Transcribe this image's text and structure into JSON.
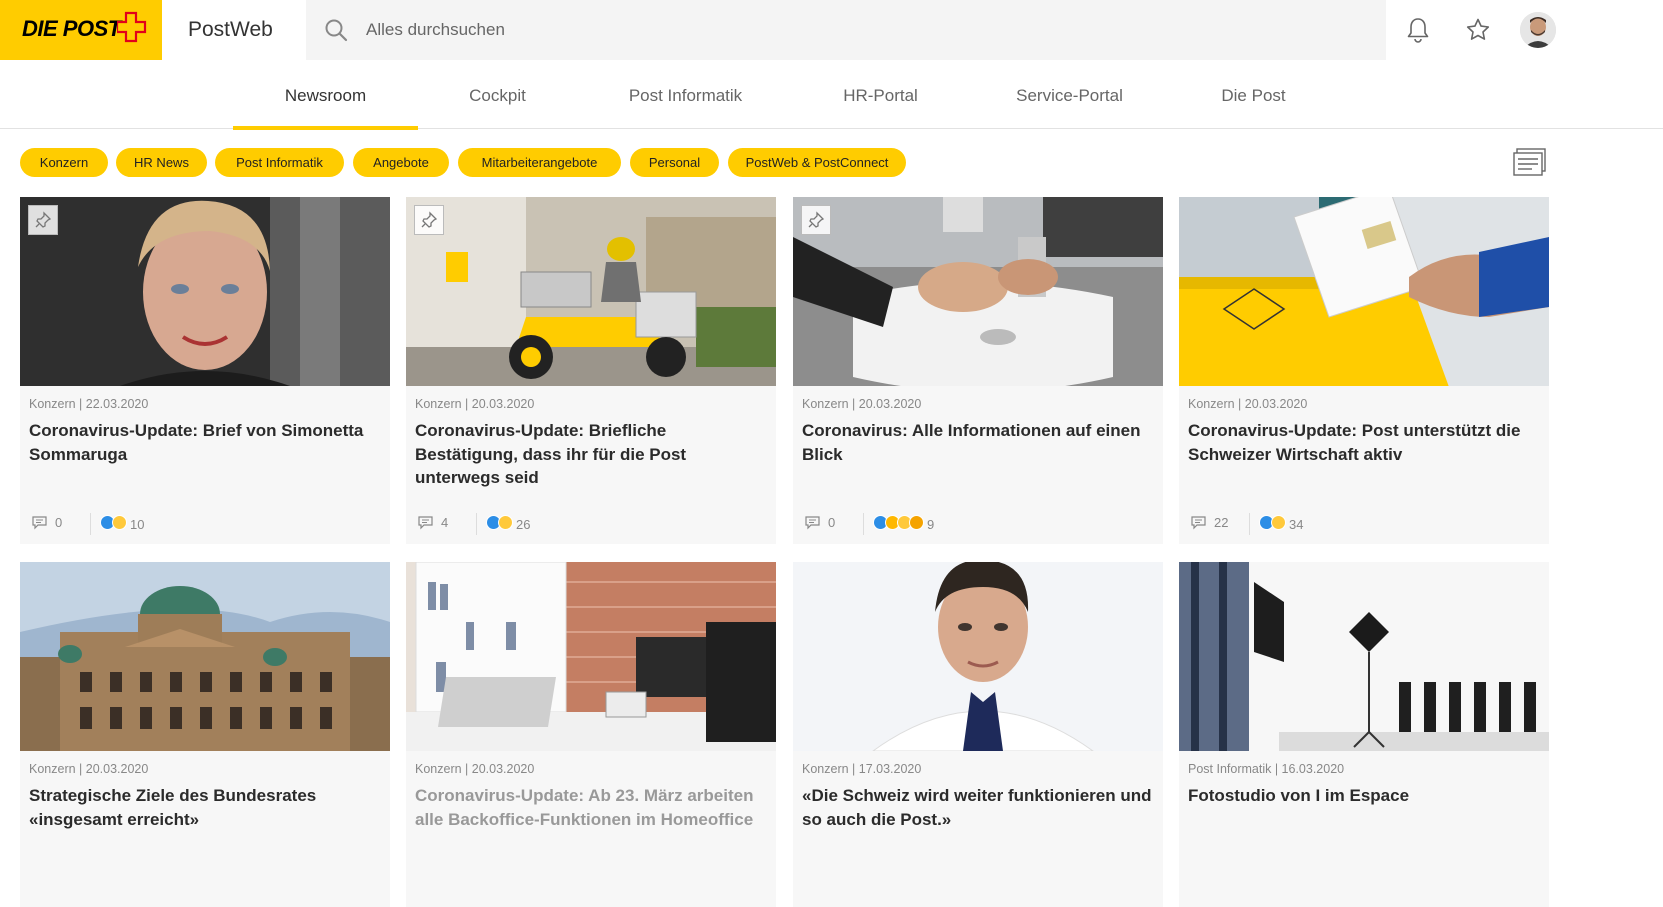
{
  "header": {
    "logo_text": "DIE POST",
    "app_name": "PostWeb",
    "search_placeholder": "Alles durchsuchen"
  },
  "nav": {
    "tabs": [
      {
        "label": "Newsroom",
        "active": true
      },
      {
        "label": "Cockpit"
      },
      {
        "label": "Post Informatik"
      },
      {
        "label": "HR-Portal"
      },
      {
        "label": "Service-Portal"
      },
      {
        "label": "Die Post"
      }
    ]
  },
  "filters": [
    "Konzern",
    "HR News",
    "Post Informatik",
    "Angebote",
    "Mitarbeiterangebote",
    "Personal",
    "PostWeb & PostConnect"
  ],
  "colors": {
    "brand_yellow": "#ffcc00",
    "like_blue": "#2d8ee6"
  },
  "cards": [
    {
      "meta": "Konzern | 22.03.2020",
      "title": "Coronavirus-Update: Brief von Simonetta Sommaruga",
      "comments": "0",
      "reactions": "10",
      "pinned": true
    },
    {
      "meta": "Konzern | 20.03.2020",
      "title": "Coronavirus-Update: Briefliche Bestätigung, dass ihr für die Post unterwegs seid",
      "comments": "4",
      "reactions": "26",
      "pinned": true
    },
    {
      "meta": "Konzern | 20.03.2020",
      "title": "Coronavirus: Alle Informationen auf einen Blick",
      "comments": "0",
      "reactions": "9",
      "pinned": true
    },
    {
      "meta": "Konzern | 20.03.2020",
      "title": "Coronavirus-Update: Post unterstützt die Schweizer Wirtschaft aktiv",
      "comments": "22",
      "reactions": "34",
      "pinned": false
    },
    {
      "meta": "Konzern | 20.03.2020",
      "title": "Strategische Ziele des Bundesrates «insgesamt erreicht»"
    },
    {
      "meta": "Konzern | 20.03.2020",
      "title": "Coronavirus-Update: Ab 23. März arbeiten alle Backoffice-Funktionen im Homeoffice"
    },
    {
      "meta": "Konzern | 17.03.2020",
      "title": "«Die Schweiz wird weiter funktionieren und so auch die Post.»"
    },
    {
      "meta": "Post Informatik | 16.03.2020",
      "title": "Fotostudio von I im Espace"
    }
  ]
}
